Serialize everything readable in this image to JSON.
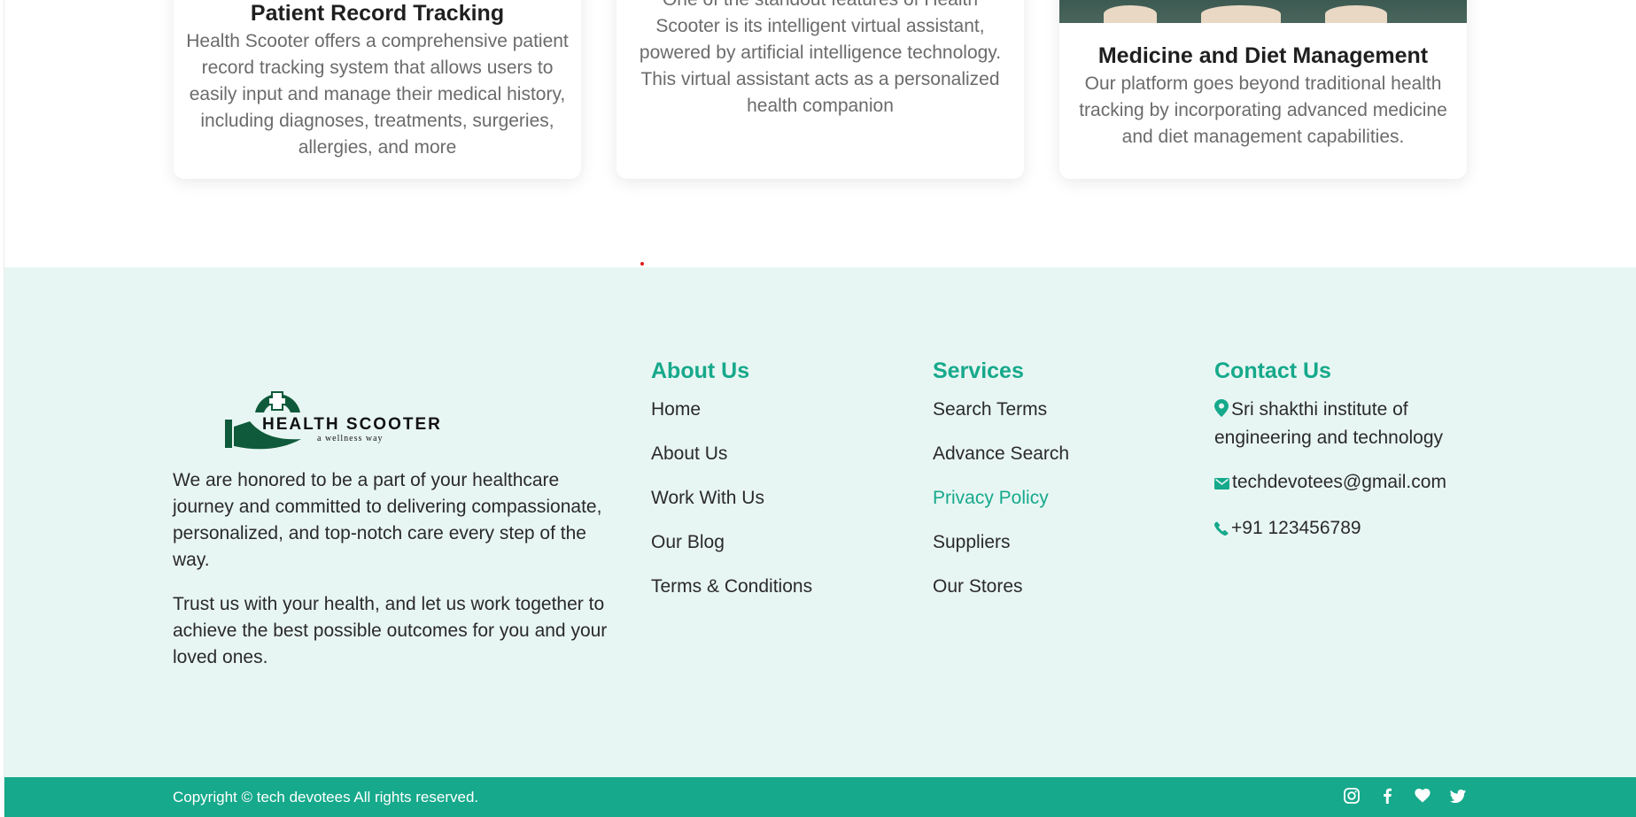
{
  "cards": [
    {
      "title": "Patient Record Tracking",
      "description": "Health Scooter offers a comprehensive patient record tracking system that allows users to easily input and manage their medical history, including diagnoses, treatments, surgeries, allergies, and more"
    },
    {
      "title": "",
      "description": "One of the standout features of Health Scooter is its intelligent virtual assistant, powered by artificial intelligence technology. This virtual assistant acts as a personalized health companion"
    },
    {
      "title": "Medicine and Diet Management",
      "description": "Our platform goes beyond traditional health tracking by incorporating advanced medicine and diet management capabilities."
    }
  ],
  "footer": {
    "logo": {
      "name": "HEALTH SCOOTER",
      "tagline": "a wellness way"
    },
    "about_paragraphs": [
      "We are honored to be a part of your healthcare journey and committed to delivering compassionate, personalized, and top-notch care every step of the way.",
      "Trust us with your health, and let us work together to achieve the best possible outcomes for you and your loved ones."
    ],
    "about_us": {
      "title": "About Us",
      "links": [
        "Home",
        "About Us",
        "Work With Us",
        "Our Blog",
        "Terms & Conditions"
      ]
    },
    "services": {
      "title": "Services",
      "links": [
        "Search Terms",
        "Advance Search",
        "Privacy Policy",
        "Suppliers",
        "Our Stores"
      ],
      "active_link": "Privacy Policy"
    },
    "contact": {
      "title": "Contact Us",
      "address": "Sri shakthi institute of engineering and technology",
      "email": "techdevotees@gmail.com",
      "phone": "+91 123456789"
    },
    "copyright": "Copyright © tech devotees All rights reserved.",
    "socials": [
      "instagram-icon",
      "facebook-icon",
      "heart-icon",
      "twitter-icon"
    ]
  },
  "colors": {
    "accent": "#16a98b",
    "footer_bg": "#e8f6f3",
    "logo_green": "#0f5a3a"
  }
}
